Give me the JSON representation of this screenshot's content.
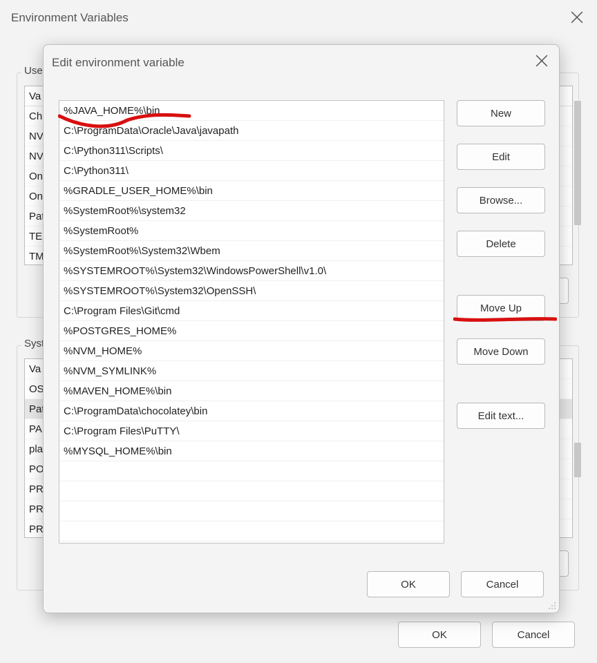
{
  "parent_dialog": {
    "title": "Environment Variables",
    "ok_label": "OK",
    "cancel_label": "Cancel",
    "group_user_label": "User",
    "group_system_label": "Syste",
    "user_header": "Va",
    "user_rows": [
      "Ch",
      "NV",
      "NV",
      "On",
      "On",
      "Pat",
      "TEI",
      "TM"
    ],
    "system_rows": [
      "Va",
      "OS",
      "Pat",
      "PA",
      "pla",
      "PO",
      "PR",
      "PR",
      "PR"
    ],
    "system_selected_index": 2
  },
  "edit_dialog": {
    "title": "Edit environment variable",
    "entries": [
      "%JAVA_HOME%\\bin",
      "C:\\ProgramData\\Oracle\\Java\\javapath",
      "C:\\Python311\\Scripts\\",
      "C:\\Python311\\",
      "%GRADLE_USER_HOME%\\bin",
      "%SystemRoot%\\system32",
      "%SystemRoot%",
      "%SystemRoot%\\System32\\Wbem",
      "%SYSTEMROOT%\\System32\\WindowsPowerShell\\v1.0\\",
      "%SYSTEMROOT%\\System32\\OpenSSH\\",
      "C:\\Program Files\\Git\\cmd",
      "%POSTGRES_HOME%",
      "%NVM_HOME%",
      "%NVM_SYMLINK%",
      "%MAVEN_HOME%\\bin",
      "C:\\ProgramData\\chocolatey\\bin",
      "C:\\Program Files\\PuTTY\\",
      "%MYSQL_HOME%\\bin"
    ],
    "buttons": {
      "new": "New",
      "edit": "Edit",
      "browse": "Browse...",
      "delete": "Delete",
      "move_up": "Move Up",
      "move_down": "Move Down",
      "edit_text": "Edit text..."
    },
    "ok_label": "OK",
    "cancel_label": "Cancel"
  },
  "annotation_color": "#d81010"
}
